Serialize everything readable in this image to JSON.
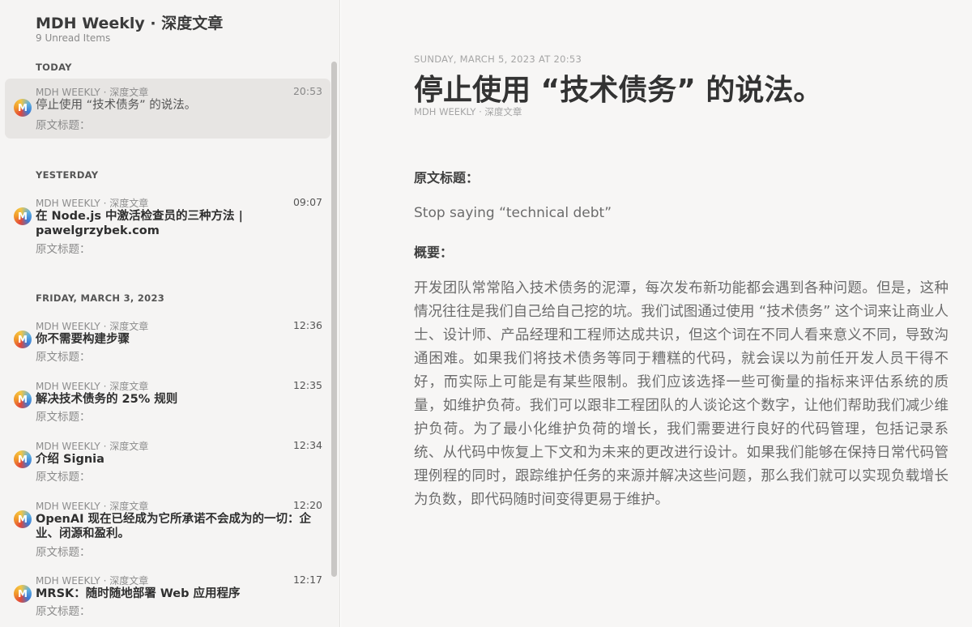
{
  "sidebar": {
    "title": "MDH Weekly · 深度文章",
    "subtitle": "9 Unread Items",
    "sections": {
      "today": "TODAY",
      "yesterday": "YESTERDAY",
      "friday": "FRIDAY, MARCH 3, 2023"
    },
    "items": [
      {
        "avatar": "M",
        "feed": "MDH WEEKLY · 深度文章",
        "time": "20:53",
        "title": "停止使用 “技术债务” 的说法。",
        "snippet": "原文标题：",
        "selected": true
      },
      {
        "avatar": "M",
        "feed": "MDH WEEKLY · 深度文章",
        "time": "09:07",
        "title": "在 Node.js 中激活检查员的三种方法 | pawelgrzybek.com",
        "snippet": "原文标题："
      },
      {
        "avatar": "M",
        "feed": "MDH WEEKLY · 深度文章",
        "time": "12:36",
        "title": "你不需要构建步骤",
        "snippet": "原文标题："
      },
      {
        "avatar": "M",
        "feed": "MDH WEEKLY · 深度文章",
        "time": "12:35",
        "title": "解决技术债务的 25% 规则",
        "snippet": "原文标题："
      },
      {
        "avatar": "M",
        "feed": "MDH WEEKLY · 深度文章",
        "time": "12:34",
        "title": "介绍 Signia",
        "snippet": "原文标题："
      },
      {
        "avatar": "M",
        "feed": "MDH WEEKLY · 深度文章",
        "time": "12:20",
        "title": "OpenAI 现在已经成为它所承诺不会成为的一切：企业、闭源和盈利。",
        "snippet": "原文标题："
      },
      {
        "avatar": "M",
        "feed": "MDH WEEKLY · 深度文章",
        "time": "12:17",
        "title": "MRSK：随时随地部署 Web 应用程序",
        "snippet": "原文标题："
      }
    ]
  },
  "article": {
    "date": "SUNDAY, MARCH 5, 2023 AT 20:53",
    "title": "停止使用 “技术债务” 的说法。",
    "feed": "MDH WEEKLY · 深度文章",
    "heading_original": "原文标题：",
    "original_title": "Stop saying “technical debt”",
    "heading_summary": "概要：",
    "summary": "开发团队常常陷入技术债务的泥潭，每次发布新功能都会遇到各种问题。但是，这种情况往往是我们自己给自己挖的坑。我们试图通过使用 “技术债务” 这个词来让商业人士、设计师、产品经理和工程师达成共识，但这个词在不同人看来意义不同，导致沟通困难。如果我们将技术债务等同于糟糕的代码，就会误以为前任开发人员干得不好，而实际上可能是有某些限制。我们应该选择一些可衡量的指标来评估系统的质量，如维护负荷。我们可以跟非工程团队的人谈论这个数字，让他们帮助我们减少维护负荷。为了最小化维护负荷的增长，我们需要进行良好的代码管理，包括记录系统、从代码中恢复上下文和为未来的更改进行设计。如果我们能够在保持日常代码管理例程的同时，跟踪维护任务的来源并解决这些问题，那么我们就可以实现负载增长为负数，即代码随时间变得更易于维护。"
  },
  "colors": {
    "sidebar_bg": "#f5f4f3",
    "article_bg": "#f7f6f5",
    "selected_bg": "#e7e5e3"
  }
}
